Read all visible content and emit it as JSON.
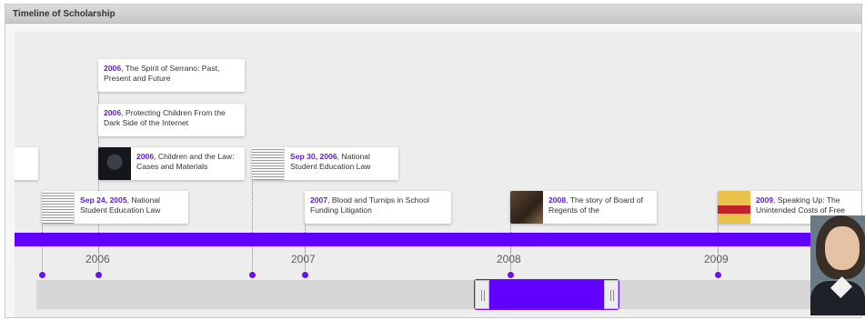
{
  "panel": {
    "title": "Timeline of Scholarship"
  },
  "events": [
    {
      "date": "2006",
      "title": ", The Spirit of Serrano: Past, Present and Future"
    },
    {
      "date": "2006",
      "title": ", Protecting Children From the Dark Side of the Internet"
    },
    {
      "date": "2006",
      "title": ", Children and the Law: Cases and Materials"
    },
    {
      "date": "Sep 30, 2006",
      "title": ", National Student Education Law"
    },
    {
      "date": "Sep 24, 2005",
      "title": ", National Student Education Law"
    },
    {
      "date": "2007",
      "title": ", Blood and Turnips in School Funding Litigation"
    },
    {
      "date": "2008",
      "title": ", The story of Board of Regents of the"
    },
    {
      "date": "2009",
      "title": ", Speaking Up: The Unintended Costs of Free"
    }
  ],
  "axis": {
    "years": [
      "2006",
      "2007",
      "2008",
      "2009"
    ]
  },
  "colors": {
    "accent": "#6200ff",
    "date_text": "#5b1fd6"
  }
}
